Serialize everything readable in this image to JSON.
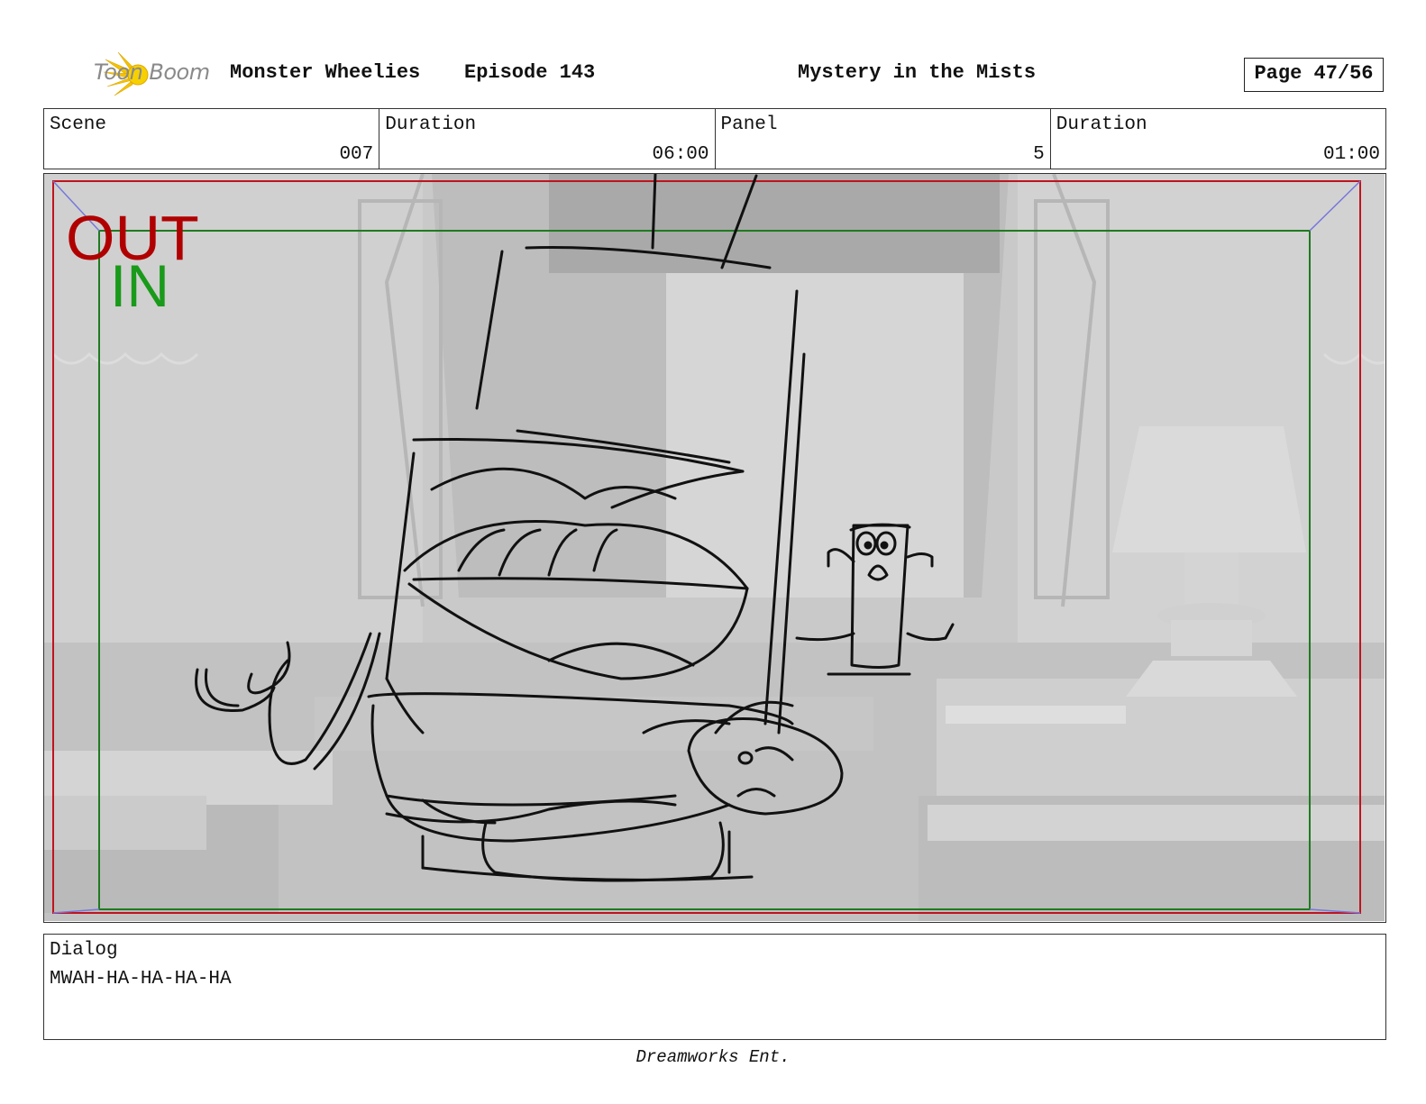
{
  "header": {
    "logo_text": "Toon Boom",
    "show": "Monster Wheelies",
    "episode": "Episode 143",
    "title": "Mystery in the Mists",
    "page": "Page 47/56"
  },
  "info": {
    "scene_label": "Scene",
    "scene_value": "007",
    "scene_duration_label": "Duration",
    "scene_duration_value": "06:00",
    "panel_label": "Panel",
    "panel_value": "5",
    "panel_duration_label": "Duration",
    "panel_duration_value": "01:00"
  },
  "frame": {
    "out_label": "OUT",
    "in_label": "IN",
    "out_color": "#b00000",
    "in_color": "#1a9a1a"
  },
  "dialog": {
    "label": "Dialog",
    "text": "MWAH-HA-HA-HA-HA"
  },
  "footer": "Dreamworks Ent."
}
